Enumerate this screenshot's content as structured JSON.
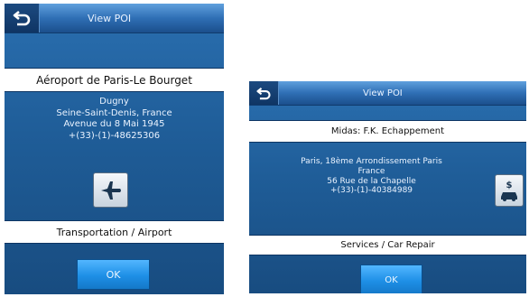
{
  "screens": [
    {
      "title": "View POI",
      "back_icon": "back-arrow-icon",
      "poi_name": "Aéroport de Paris-Le Bourget",
      "details": [
        "Dugny",
        "Seine-Saint-Denis, France",
        "Avenue du 8 Mai 1945",
        "+(33)-(1)-48625306"
      ],
      "category_icon": "airplane-icon",
      "category": "Transportation / Airport",
      "ok_label": "OK"
    },
    {
      "title": "View POI",
      "back_icon": "back-arrow-icon",
      "poi_name": "Midas: F.K. Echappement",
      "details": [
        "Paris, 18ème Arrondissement Paris",
        "France",
        "56 Rue de la Chapelle",
        "+(33)-(1)-40384989"
      ],
      "category_icon": "car-repair-icon",
      "category": "Services / Car Repair",
      "ok_label": "OK"
    }
  ],
  "colors": {
    "title_bar": "#2f6fb5",
    "background": "#1f5d98",
    "ok_button": "#1e8fe6",
    "text_light": "#eaf3ff"
  }
}
